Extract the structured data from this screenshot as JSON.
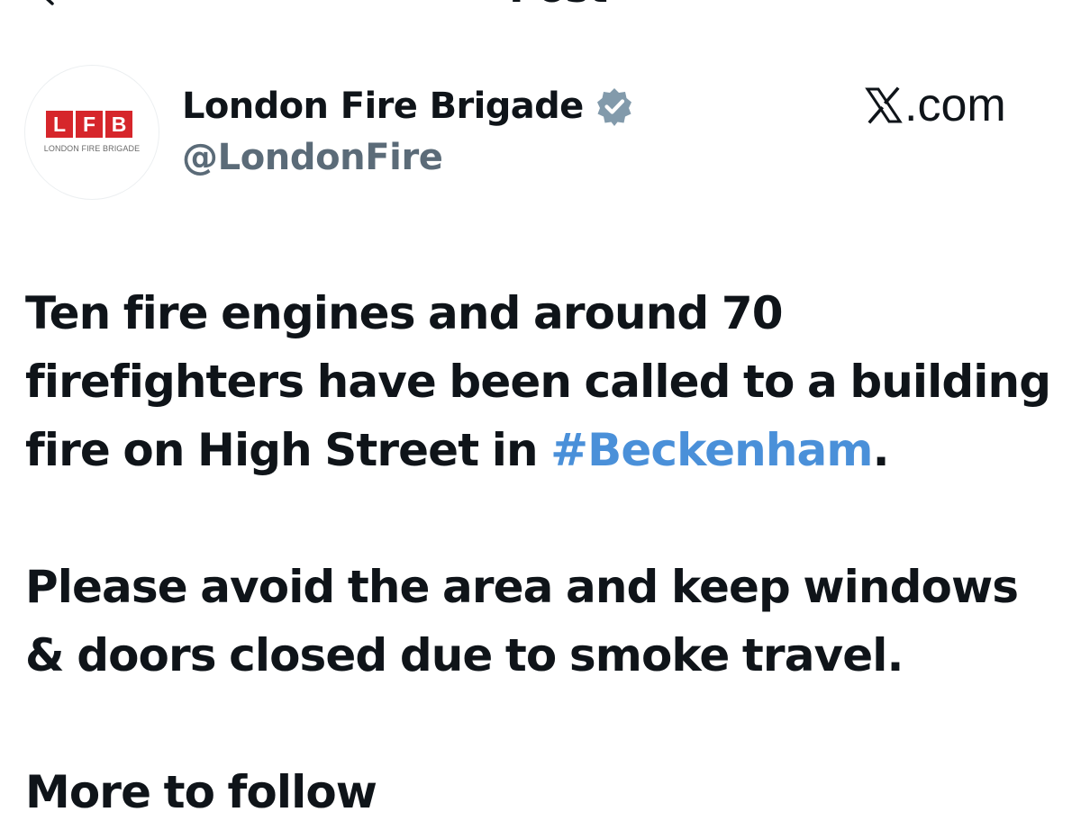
{
  "topbar": {
    "title": "Post",
    "back_icon": "back-arrow-icon"
  },
  "author": {
    "avatar_letters": [
      "L",
      "F",
      "B"
    ],
    "avatar_subtitle": "LONDON FIRE BRIGADE",
    "display_name": "London Fire Brigade",
    "handle": "@LondonFire",
    "verified_icon": "verified-badge-icon",
    "verified_color": "#829aab"
  },
  "brand": {
    "icon": "x-logo-icon",
    "text": ".com"
  },
  "post": {
    "line1": "Ten fire engines and around 70",
    "line2": "firefighters have been called to a building",
    "line3_prefix": "fire on High Street in ",
    "hashtag": "#Beckenham",
    "line3_suffix": ".",
    "line4": "Please avoid the area and keep windows",
    "line5": "& doors closed due to smoke travel.",
    "line6": "More to follow"
  },
  "colors": {
    "brand_red": "#d6262b",
    "hashtag_blue": "#4a90d9",
    "handle_gray": "#5b6b78",
    "text": "#0f1419"
  }
}
